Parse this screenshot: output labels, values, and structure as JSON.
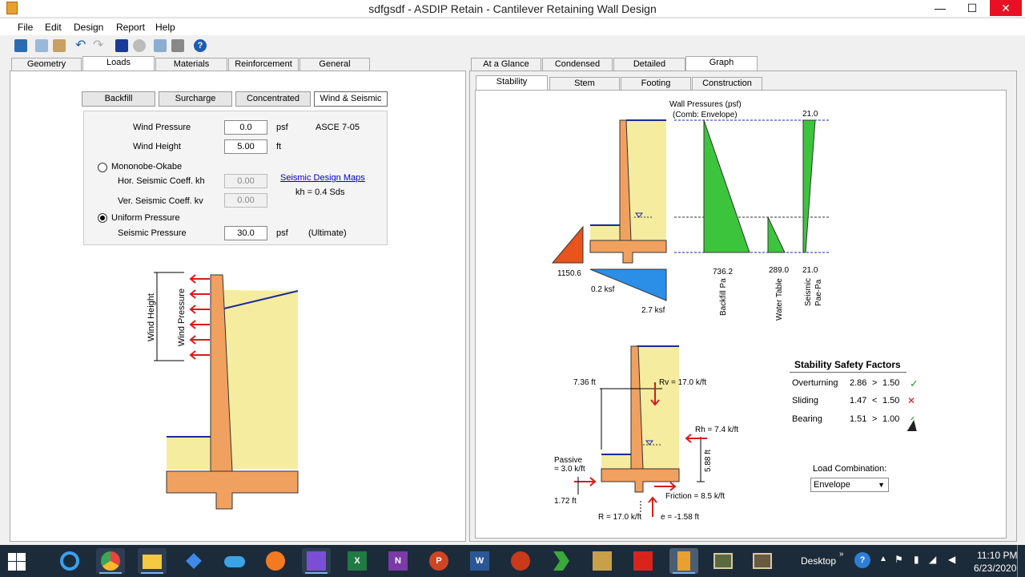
{
  "window": {
    "title": "sdfgsdf - ASDIP Retain - Cantilever Retaining Wall Design",
    "min": "—",
    "max": "☐",
    "close": "✕"
  },
  "menu": [
    "File",
    "Edit",
    "Design",
    "Report",
    "Help"
  ],
  "toolbar_icons": [
    "pm-icon",
    "copy-icon",
    "paste-icon",
    "undo-icon",
    "redo-icon",
    "design-icon",
    "settings-icon",
    "preview-icon",
    "print-icon",
    "help-icon"
  ],
  "left_tabs": [
    "Geometry",
    "Loads",
    "Materials",
    "Reinforcement",
    "General"
  ],
  "left_active_tab": "Loads",
  "load_buttons": [
    "Backfill",
    "Surcharge",
    "Concentrated",
    "Wind & Seismic"
  ],
  "load_active": "Wind & Seismic",
  "form": {
    "wind_pressure_label": "Wind Pressure",
    "wind_pressure_value": "0.0",
    "wind_pressure_unit": "psf",
    "code": "ASCE 7-05",
    "wind_height_label": "Wind Height",
    "wind_height_value": "5.00",
    "wind_height_unit": "ft",
    "mononobe_label": "Mononobe-Okabe",
    "kh_label": "Hor. Seismic Coeff. kh",
    "kh_value": "0.00",
    "kv_label": "Ver. Seismic Coeff. kv",
    "kv_value": "0.00",
    "maps_link": "Seismic Design Maps",
    "kh_note": "kh = 0.4 Sds",
    "uniform_label": "Uniform Pressure",
    "seismic_label": "Seismic Pressure",
    "seismic_value": "30.0",
    "seismic_unit": "psf",
    "seismic_note": "(Ultimate)"
  },
  "wall_diagram": {
    "wind_height_label": "Wind Height",
    "wind_pressure_label": "Wind Pressure"
  },
  "right_tabs": [
    "At a Glance",
    "Condensed",
    "Detailed",
    "Graph"
  ],
  "right_active_tab": "Graph",
  "graph_tabs": [
    "Stability",
    "Stem",
    "Footing",
    "Construction"
  ],
  "graph_active": "Stability",
  "pressures": {
    "title1": "Wall Pressures (psf)",
    "title2": "(Comb: Envelope)",
    "top_value": "21.0",
    "backfill_value": "736.2",
    "water_value": "289.0",
    "seismic_value": "21.0",
    "backfill_label": "Backfill Pa",
    "water_label": "Water Table",
    "seismic_label1": "Seismic",
    "seismic_label2": "Pae-Pa",
    "passive_value": "1150.6",
    "bearing_left": "0.2 ksf",
    "bearing_right": "2.7 ksf"
  },
  "stability_diagram": {
    "height_top": "7.36 ft",
    "rv": "Rv = 17.0 k/ft",
    "rh": "Rh = 7.4 k/ft",
    "rh_arm": "5.88 ft",
    "passive1": "Passive",
    "passive2": "= 3.0 k/ft",
    "passive_arm": "1.72 ft",
    "friction": "Friction = 8.5 k/ft",
    "r": "R = 17.0 k/ft",
    "e": "e = -1.58 ft"
  },
  "safety": {
    "title": "Stability Safety Factors",
    "rows": [
      {
        "name": "Overturning",
        "value": "2.86",
        "op": ">",
        "limit": "1.50",
        "ok": "✓"
      },
      {
        "name": "Sliding",
        "value": "1.47",
        "op": "<",
        "limit": "1.50",
        "ok": "✕"
      },
      {
        "name": "Bearing",
        "value": "1.51",
        "op": ">",
        "limit": "1.00",
        "ok": "✓"
      }
    ],
    "combo_label": "Load Combination:",
    "combo_value": "Envelope"
  },
  "taskbar": {
    "apps": [
      "ie-icon",
      "chrome-icon",
      "file-explorer-icon",
      "dropbox-icon",
      "onedrive-icon",
      "firefox-icon",
      "visual-studio-icon",
      "excel-icon",
      "onenote-icon",
      "powerpoint-icon",
      "word-icon",
      "app-icon",
      "app-green-icon",
      "app-tools-icon",
      "acrobat-icon",
      "asdip-icon",
      "media-icon",
      "media2-icon"
    ],
    "desktop_label": "Desktop",
    "time": "11:10 PM",
    "date": "6/23/2020"
  }
}
